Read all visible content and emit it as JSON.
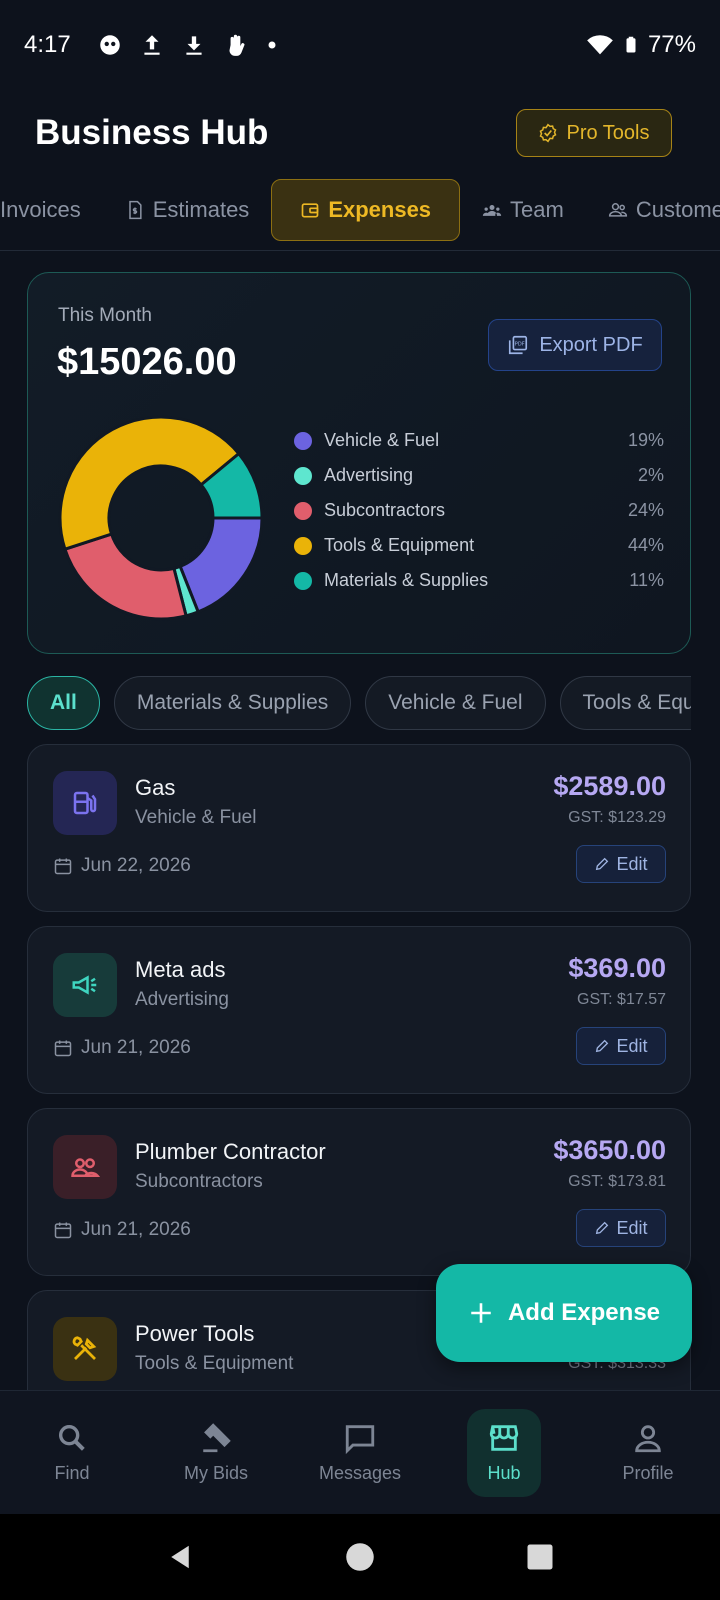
{
  "status_bar": {
    "time": "4:17",
    "battery": "77%"
  },
  "header": {
    "title": "Business Hub",
    "pro_button": "Pro Tools"
  },
  "tabs": [
    "Invoices",
    "Estimates",
    "Expenses",
    "Team",
    "Customers"
  ],
  "summary": {
    "label": "This Month",
    "total": "$15026.00",
    "export_button": "Export PDF",
    "legend": [
      {
        "name": "Vehicle & Fuel",
        "pct": "19%",
        "color": "#6c63e0"
      },
      {
        "name": "Advertising",
        "pct": "2%",
        "color": "#5ee6cf"
      },
      {
        "name": "Subcontractors",
        "pct": "24%",
        "color": "#e05e6c"
      },
      {
        "name": "Tools & Equipment",
        "pct": "44%",
        "color": "#eab308"
      },
      {
        "name": "Materials & Supplies",
        "pct": "11%",
        "color": "#14b8a6"
      }
    ]
  },
  "filters": [
    "All",
    "Materials & Supplies",
    "Vehicle & Fuel",
    "Tools & Equipment"
  ],
  "expenses": [
    {
      "name": "Gas",
      "category": "Vehicle & Fuel",
      "date": "Jun 22, 2026",
      "amount": "$2589.00",
      "gst": "GST: $123.29",
      "edit": "Edit"
    },
    {
      "name": "Meta ads",
      "category": "Advertising",
      "date": "Jun 21, 2026",
      "amount": "$369.00",
      "gst": "GST: $17.57",
      "edit": "Edit"
    },
    {
      "name": "Plumber Contractor",
      "category": "Subcontractors",
      "date": "Jun 21, 2026",
      "amount": "$3650.00",
      "gst": "GST: $173.81",
      "edit": "Edit"
    },
    {
      "name": "Power Tools",
      "category": "Tools & Equipment",
      "gst": "GST: $313.33"
    }
  ],
  "fab_label": "Add Expense",
  "nav": [
    "Find",
    "My Bids",
    "Messages",
    "Hub",
    "Profile"
  ]
}
